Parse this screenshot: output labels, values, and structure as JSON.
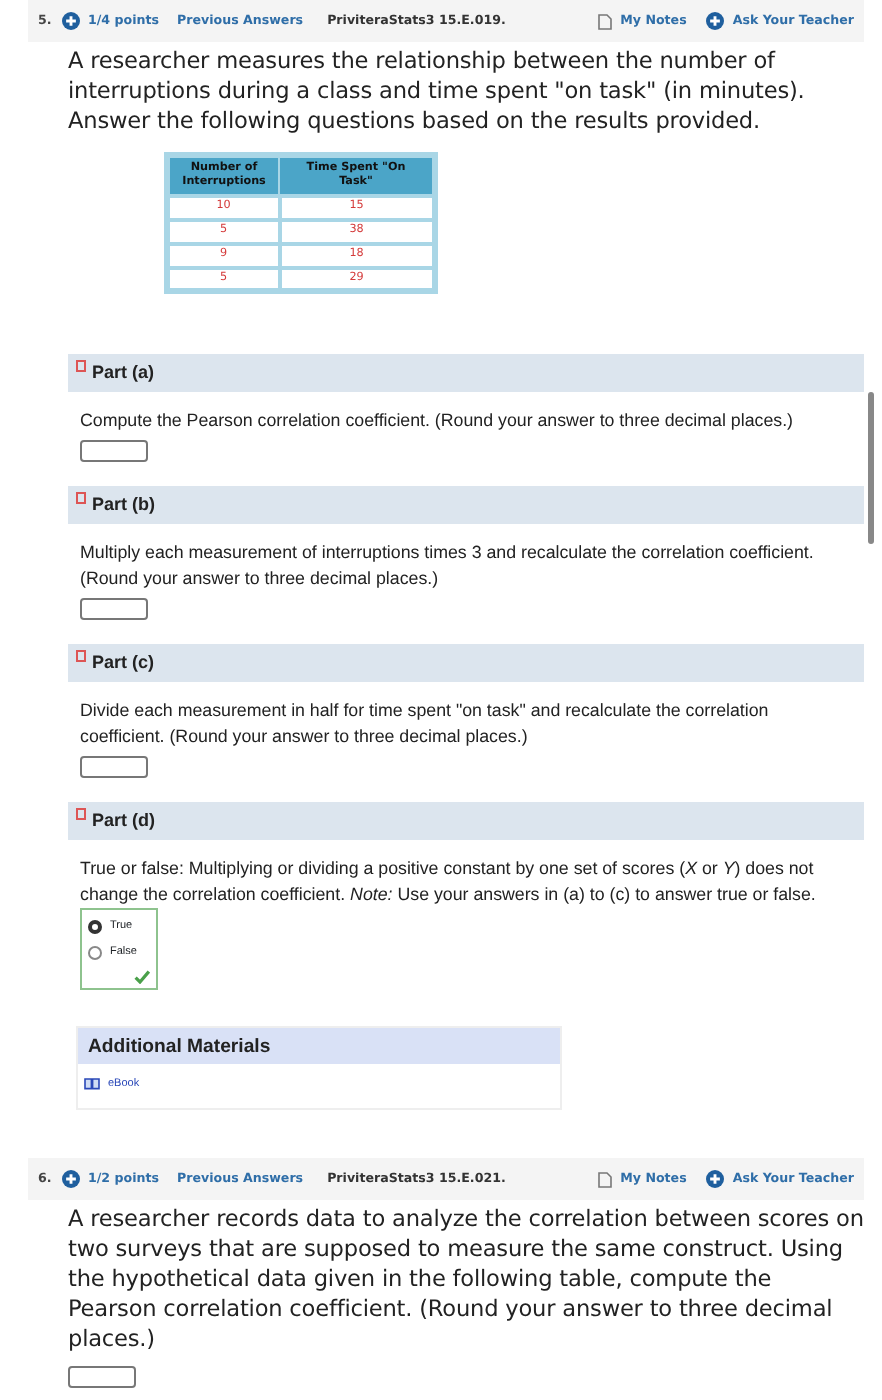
{
  "questions": [
    {
      "number": "5.",
      "points": "1/4 points",
      "previous_answers": "Previous Answers",
      "code": "PriviteraStats3 15.E.019.",
      "my_notes": "My Notes",
      "ask_teacher": "Ask Your Teacher",
      "prompt": "A researcher measures the relationship between the number of interruptions during a class and time spent \"on task\" (in minutes). Answer the following questions based on the results provided.",
      "table": {
        "columns": [
          "Number of Interruptions",
          "Time Spent \"On Task\""
        ],
        "rows": [
          [
            "10",
            "15"
          ],
          [
            "5",
            "38"
          ],
          [
            "9",
            "18"
          ],
          [
            "5",
            "29"
          ]
        ]
      },
      "parts": [
        {
          "title": "Part (a)",
          "kind": "input",
          "text": "Compute the Pearson correlation coefficient. (Round your answer to three decimal places.)"
        },
        {
          "title": "Part (b)",
          "kind": "input",
          "text": "Multiply each measurement of interruptions times 3 and recalculate the correlation coefficient. (Round your answer to three decimal places.)"
        },
        {
          "title": "Part (c)",
          "kind": "input",
          "text": "Divide each measurement in half for time spent \"on task\" and recalculate the correlation coefficient. (Round your answer to three decimal places.)"
        },
        {
          "title": "Part (d)",
          "kind": "choice",
          "text": "True or false: Multiplying or dividing a positive constant by one set of scores (*X* or *Y*) does not change the correlation coefficient. *Note:* Use your answers in (a) to (c) to answer true or false.",
          "options": [
            {
              "label": "True",
              "selected": true
            },
            {
              "label": "False",
              "selected": false
            }
          ],
          "correct": true
        }
      ],
      "additional_materials": {
        "title": "Additional Materials",
        "links": [
          "eBook"
        ]
      }
    },
    {
      "number": "6.",
      "points": "1/2 points",
      "previous_answers": "Previous Answers",
      "code": "PriviteraStats3 15.E.021.",
      "my_notes": "My Notes",
      "ask_teacher": "Ask Your Teacher",
      "prompt": "A researcher records data to analyze the correlation between scores on two surveys that are supposed to measure the same construct. Using the hypothetical data given in the following table, compute the Pearson correlation coefficient. (Round your answer to three decimal places.)"
    }
  ]
}
